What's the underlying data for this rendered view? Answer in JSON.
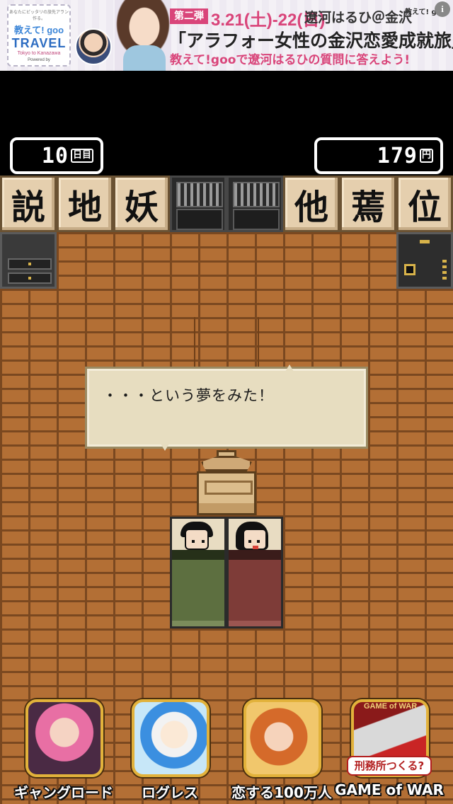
{
  "ad": {
    "stamp_small": "あなたにピッタリの旅先アラン作る。",
    "stamp_brand_top": "教えて! goo",
    "stamp_brand_main": "TRAVEL",
    "stamp_city": "Tokyo to Kanazawa",
    "stamp_powered": "Powered by",
    "tag": "第二弾",
    "dates": "3.21(土)-22(日)",
    "who": "遼河はるひ＠金沢",
    "headline": "「アラフォー女性の金沢恋愛成就旅」",
    "sub": "教えて!gooで遼河はるひの質問に答えよう!",
    "mark": "教えて! goo",
    "info": "i"
  },
  "hud": {
    "days": "10",
    "days_unit": "日目",
    "money": "179",
    "money_unit": "円"
  },
  "shelf": {
    "tiles": [
      "説",
      "地",
      "妖",
      "",
      "",
      "他",
      "蔫",
      "位"
    ]
  },
  "message": "・・・という夢をみた！",
  "apps": [
    {
      "label": "ギャングロード",
      "icon": "gang-road-app-icon"
    },
    {
      "label": "ログレス",
      "icon": "logres-app-icon"
    },
    {
      "label": "恋する100万人",
      "icon": "koisuru-app-icon"
    },
    {
      "label": "GAME of WAR",
      "icon": "game-of-war-app-icon",
      "badge": "刑務所つくる?",
      "logo": "GAME of WAR"
    }
  ]
}
